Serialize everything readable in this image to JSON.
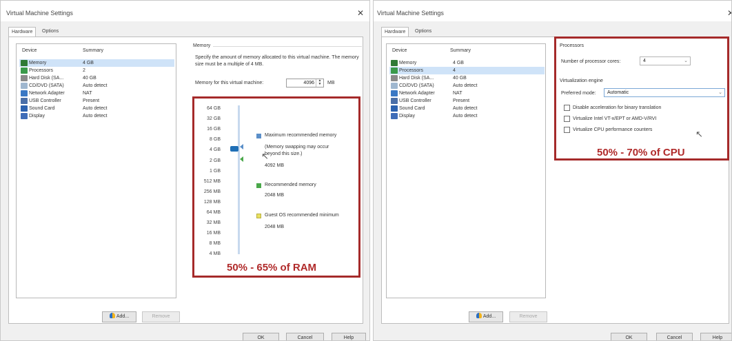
{
  "left": {
    "title": "Virtual Machine Settings",
    "close_glyph": "✕",
    "tabs": [
      "Hardware",
      "Options"
    ],
    "device_header": {
      "device": "Device",
      "summary": "Summary"
    },
    "devices": [
      {
        "name": "Memory",
        "summary": "4 GB",
        "icon": "memory-icon",
        "color": "#2f7a35"
      },
      {
        "name": "Processors",
        "summary": "2",
        "icon": "processor-icon",
        "color": "#3a9a4a"
      },
      {
        "name": "Hard Disk (SA...",
        "summary": "40 GB",
        "icon": "hard-disk-icon",
        "color": "#8a8a8a"
      },
      {
        "name": "CD/DVD (SATA)",
        "summary": "Auto detect",
        "icon": "cd-dvd-icon",
        "color": "#9fb7cf"
      },
      {
        "name": "Network Adapter",
        "summary": "NAT",
        "icon": "network-adapter-icon",
        "color": "#3a78c4"
      },
      {
        "name": "USB Controller",
        "summary": "Present",
        "icon": "usb-controller-icon",
        "color": "#4a6fa8"
      },
      {
        "name": "Sound Card",
        "summary": "Auto detect",
        "icon": "sound-card-icon",
        "color": "#2c62b0"
      },
      {
        "name": "Display",
        "summary": "Auto detect",
        "icon": "display-icon",
        "color": "#3f6db8"
      }
    ],
    "add_button": "Add...",
    "remove_button": "Remove",
    "memory_group": "Memory",
    "memory_desc": "Specify the amount of memory allocated to this virtual machine. The memory size must be a multiple of 4 MB.",
    "memory_label": "Memory for this virtual machine:",
    "memory_value": "4096",
    "memory_unit": "MB",
    "scale": [
      "64 GB",
      "32 GB",
      "16 GB",
      "8 GB",
      "4 GB",
      "2 GB",
      "1 GB",
      "512 MB",
      "256 MB",
      "128 MB",
      "64 MB",
      "32 MB",
      "16 MB",
      "8 MB",
      "4 MB"
    ],
    "max_label": "Maximum recommended memory",
    "swap_note": "(Memory swapping may occur beyond this size.)",
    "max_value": "4092 MB",
    "rec_label": "Recommended memory",
    "rec_value": "2048 MB",
    "guest_label": "Guest OS recommended minimum",
    "guest_value": "2048 MB",
    "annotation": "50% - 65% of RAM",
    "ok_button": "OK",
    "cancel_button": "Cancel",
    "help_button": "Help",
    "colors": {
      "accent": "#1f6fb6",
      "annotation": "#b02a2a",
      "max": "#5b8fc9",
      "rec": "#4aa84a",
      "guest": "#e8e060"
    }
  },
  "right": {
    "title": "Virtual Machine Settings",
    "close_glyph": "✕",
    "tabs": [
      "Hardware",
      "Options"
    ],
    "device_header": {
      "device": "Device",
      "summary": "Summary"
    },
    "devices": [
      {
        "name": "Memory",
        "summary": "4 GB",
        "icon": "memory-icon",
        "color": "#2f7a35"
      },
      {
        "name": "Processors",
        "summary": "4",
        "icon": "processor-icon",
        "color": "#3a9a4a"
      },
      {
        "name": "Hard Disk (SA...",
        "summary": "40 GB",
        "icon": "hard-disk-icon",
        "color": "#8a8a8a"
      },
      {
        "name": "CD/DVD (SATA)",
        "summary": "Auto detect",
        "icon": "cd-dvd-icon",
        "color": "#9fb7cf"
      },
      {
        "name": "Network Adapter",
        "summary": "NAT",
        "icon": "network-adapter-icon",
        "color": "#3a78c4"
      },
      {
        "name": "USB Controller",
        "summary": "Present",
        "icon": "usb-controller-icon",
        "color": "#4a6fa8"
      },
      {
        "name": "Sound Card",
        "summary": "Auto detect",
        "icon": "sound-card-icon",
        "color": "#2c62b0"
      },
      {
        "name": "Display",
        "summary": "Auto detect",
        "icon": "display-icon",
        "color": "#3f6db8"
      }
    ],
    "add_button": "Add...",
    "remove_button": "Remove",
    "processors_group": "Processors",
    "cores_label": "Number of processor cores:",
    "cores_value": "4",
    "virt_group": "Virtualization engine",
    "mode_label": "Preferred mode:",
    "mode_value": "Automatic",
    "checkboxes": [
      "Disable acceleration for binary translation",
      "Virtualize Intel VT-x/EPT or AMD-V/RVI",
      "Virtualize CPU performance counters"
    ],
    "annotation": "50% - 70% of CPU",
    "ok_button": "OK",
    "cancel_button": "Cancel",
    "help_button": "Help"
  }
}
